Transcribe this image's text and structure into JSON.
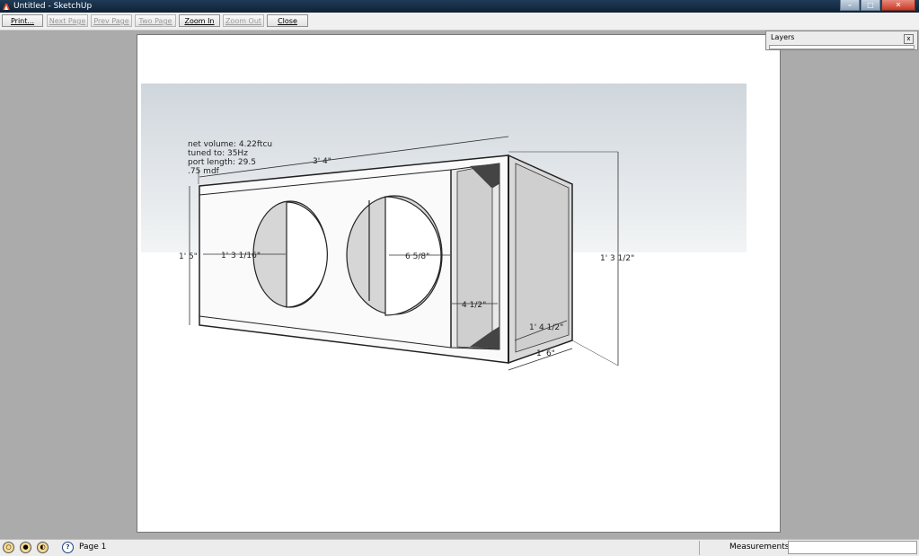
{
  "window": {
    "title": "Untitled - SketchUp",
    "min_glyph": "–",
    "max_glyph": "□",
    "close_glyph": "✕"
  },
  "toolbar": {
    "print": "Print...",
    "next_page": "Next Page",
    "prev_page": "Prev Page",
    "two_page": "Two Page",
    "zoom_in": "Zoom In",
    "zoom_out": "Zoom Out",
    "close": "Close"
  },
  "layers_panel": {
    "title": "Layers",
    "close_glyph": "x"
  },
  "drawing": {
    "notes": [
      "net volume: 4.22ftcu",
      "tuned to: 35Hz",
      "port length: 29.5",
      ".75 mdf"
    ],
    "dimensions": {
      "length": "3' 4\"",
      "height_left": "1' 5\"",
      "driver_offset": "1' 3 1/16\"",
      "driver_gap": "6 5/8\"",
      "port_width": "4 1/2\"",
      "inner_depth": "1' 4 1/2\"",
      "depth": "1' 6\"",
      "height_right": "1' 3 1/2\""
    }
  },
  "statusbar": {
    "help_glyph": "?",
    "page_label": "Page 1",
    "measurements_label": "Measurements"
  }
}
